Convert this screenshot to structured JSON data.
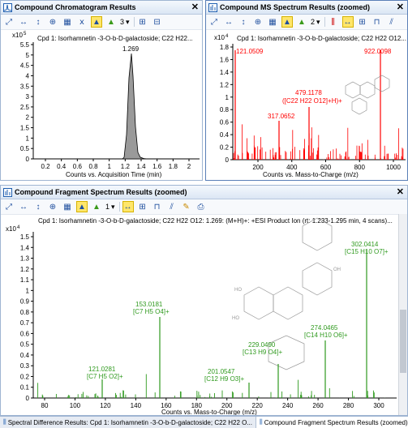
{
  "panels": {
    "chromatogram": {
      "title": "Compound Chromatogram Results",
      "dropdown_value": "3",
      "compound_label": "Cpd 1: Isorhamnetin -3-O-b-D-galactoside; C22 H22...",
      "y_exponent": "x10",
      "y_exponent_power": "5",
      "peak_label": "1.269",
      "x_axis_label": "Counts vs. Acquisition Time (min)",
      "y_ticks": [
        "5.5",
        "5",
        "4.5",
        "4",
        "3.5",
        "3",
        "2.5",
        "2",
        "1.5",
        "1",
        "0.5",
        "0"
      ],
      "x_ticks": [
        "0.2",
        "0.4",
        "0.6",
        "0.8",
        "1",
        "1.2",
        "1.4",
        "1.6",
        "1.8",
        "2"
      ]
    },
    "ms_spectrum": {
      "title": "Compound MS Spectrum Results (zoomed)",
      "dropdown_value": "2",
      "compound_label": "Cpd 1: Isorhamnetin -3-O-b-D-galactoside; C22 H22 O12...",
      "y_exponent": "x10",
      "y_exponent_power": "4",
      "x_axis_label": "Counts vs. Mass-to-Charge (m/z)",
      "y_ticks": [
        "1.8",
        "1.6",
        "1.4",
        "1.2",
        "1",
        "0.8",
        "0.6",
        "0.4",
        "0.2",
        "0"
      ],
      "x_ticks": [
        "200",
        "400",
        "600",
        "800",
        "1000"
      ],
      "peak_labels": {
        "p1": "121.0509",
        "p2": "922.0098",
        "p3a": "479.1178",
        "p3b": "([C22 H22 O12]+H)+",
        "p4": "317.0652"
      }
    },
    "fragment": {
      "title": "Compound Fragment Spectrum Results (zoomed)",
      "dropdown_value": "1",
      "compound_label": "Cpd 1: Isorhamnetin -3-O-b-D-galactoside; C22 H22 O12: 1.269: (M+H)+: +ESI Product Ion (rt: 1.233-1.295 min, 4 scans)...",
      "y_exponent": "x10",
      "y_exponent_power": "4",
      "x_axis_label": "Counts vs. Mass-to-Charge (m/z)",
      "y_ticks": [
        "1.5",
        "1.4",
        "1.3",
        "1.2",
        "1.1",
        "1",
        "0.9",
        "0.8",
        "0.7",
        "0.6",
        "0.5",
        "0.4",
        "0.3",
        "0.2",
        "0.1",
        "0"
      ],
      "x_ticks": [
        "80",
        "100",
        "120",
        "140",
        "160",
        "180",
        "200",
        "220",
        "240",
        "260",
        "280",
        "300"
      ],
      "peak_labels": {
        "a1": "302.0414",
        "a2": "[C15 H10 O7]+",
        "b1": "153.0181",
        "b2": "[C7 H5 O4]+",
        "c1": "274.0465",
        "c2": "[C14 H10 O6]+",
        "d1": "229.0490",
        "d2": "[C13 H9 O4]+",
        "e1": "121.0281",
        "e2": "[C7 H5 O2]+",
        "f1": "201.0547",
        "f2": "[C12 H9 O3]+"
      }
    }
  },
  "tabs": [
    "Spectral Difference Results: Cpd 1: Isorhamnetin -3-O-b-D-galactoside; C22 H22 O...",
    "Compound Fragment Spectrum Results (zoomed)"
  ],
  "icons": {
    "chromatogram_panel": "chromatogram-icon",
    "spectrum_panel": "spectrum-icon",
    "close": "close-icon"
  },
  "colors": {
    "chrom_line": "#000000",
    "chrom_fill": "#9a9a9a",
    "ms_peaks": "#ff0000",
    "fragment_peaks": "#2f9a1e",
    "accent_highlight": "#ffe66a",
    "titlebar": "#dbe6f4"
  }
}
